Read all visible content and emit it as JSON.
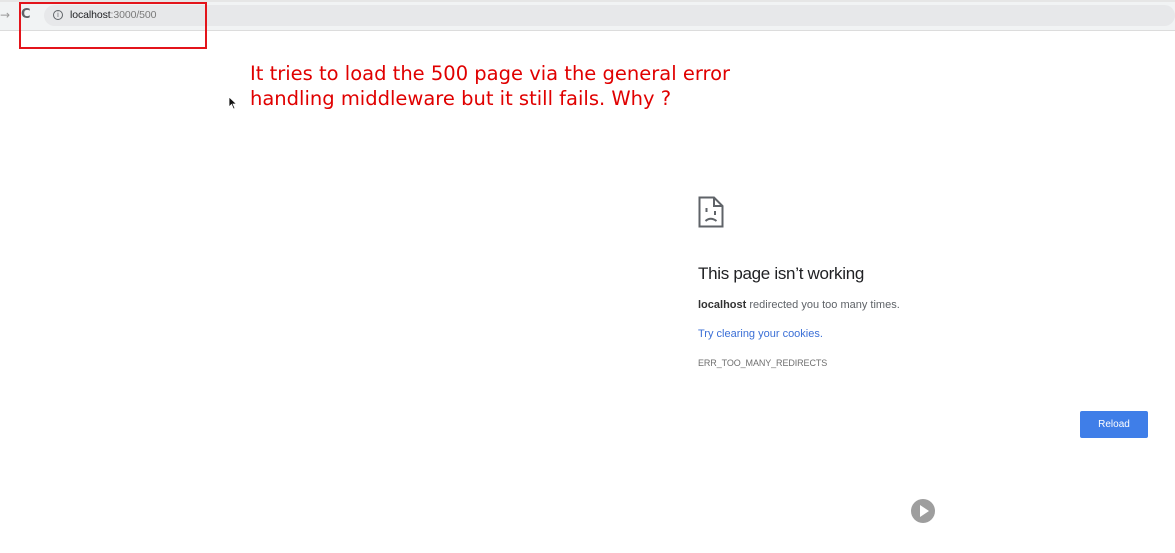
{
  "browser": {
    "forward_icon": "→",
    "reload_icon": "C",
    "address_bar": {
      "info_icon": "i",
      "host": "localhost",
      "path": ":3000/500"
    }
  },
  "annotation": {
    "line1": "It tries to load the 500 page via the general error",
    "line2": "handling middleware but it still fails. Why ?",
    "color": "#e00000",
    "box_color": "#e3141b"
  },
  "error_page": {
    "icon": "sad-document-icon",
    "title": "This page isn’t working",
    "desc_host": "localhost",
    "desc_rest": " redirected you too many times.",
    "link": "Try clearing your cookies.",
    "error_code": "ERR_TOO_MANY_REDIRECTS",
    "reload_label": "Reload",
    "accent": "#3f7ee8"
  },
  "overlay": {
    "play_icon": "play-icon"
  }
}
